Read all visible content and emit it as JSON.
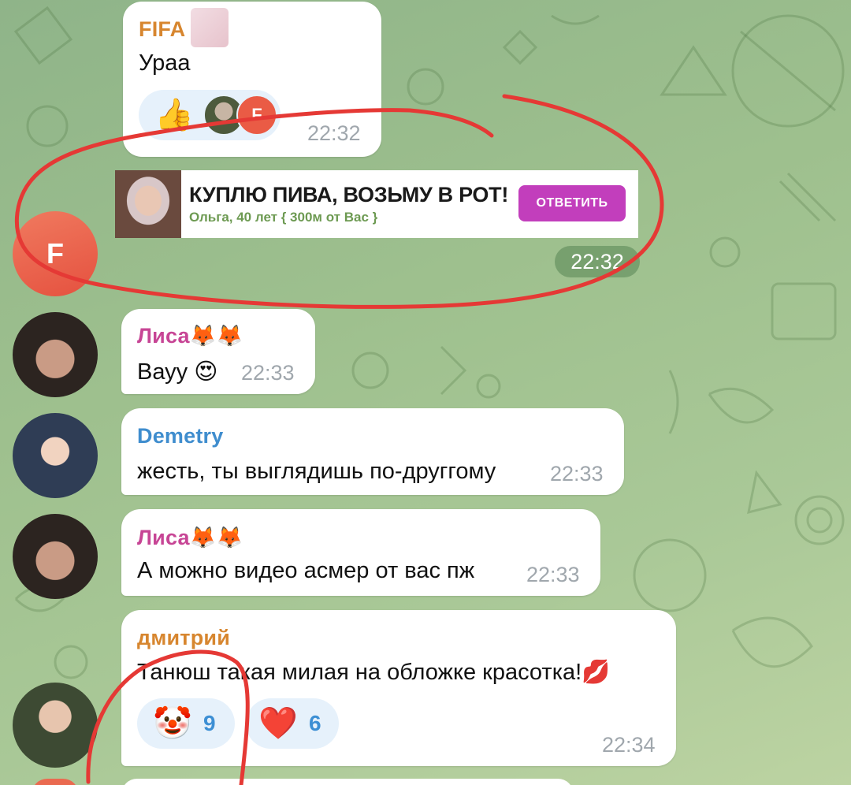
{
  "colors": {
    "fifa_name": "#d7862f",
    "lisa_name": "#c74595",
    "demetry_name": "#3f8dce",
    "dmitry_name": "#d7862f",
    "annotation_red": "#e53935",
    "ad_button": "#c23ebc"
  },
  "messages": [
    {
      "sender": "FIFA",
      "text": "Ураа",
      "time": "22:32",
      "reaction_icon": "thumbs-up-icon"
    },
    {
      "sender": "Лиса🦊🦊",
      "text": "Вауу 😍",
      "time": "22:33"
    },
    {
      "sender": "Demetry",
      "text": "жесть, ты выглядишь по-друггому",
      "time": "22:33"
    },
    {
      "sender": "Лиса🦊🦊",
      "text": "А можно видео асмер от вас пж",
      "time": "22:33"
    },
    {
      "sender": "дмитрий",
      "text": "Танюш такая милая на обложке красотка!💋",
      "time": "22:34"
    }
  ],
  "ad": {
    "title": "КУПЛЮ ПИВА, ВОЗЬМУ В РОТ!",
    "subtitle": "Ольга, 40 лет { 300м от Вас }",
    "button": "ОТВЕТИТЬ",
    "time": "22:32",
    "avatar_letter": "F"
  },
  "reactions": {
    "fifa_user_letter": "F",
    "clown": {
      "emoji": "🤡",
      "count": "9"
    },
    "heart": {
      "emoji": "❤️",
      "count": "6"
    }
  }
}
